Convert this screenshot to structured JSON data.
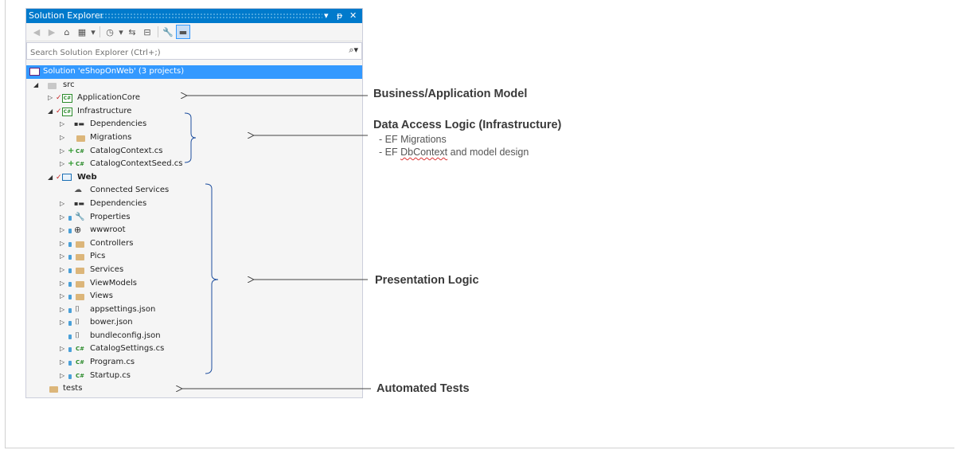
{
  "panel": {
    "title": "Solution Explorer",
    "controls": {
      "dropdown": "▾",
      "pin": "ᵽ",
      "close": "✕"
    },
    "search_placeholder": "Search Solution Explorer (Ctrl+;)"
  },
  "tree": {
    "solution": "Solution 'eShopOnWeb' (3 projects)",
    "src": "src",
    "application_core": "ApplicationCore",
    "infrastructure": "Infrastructure",
    "infra_dependencies": "Dependencies",
    "migrations": "Migrations",
    "catalog_context": "CatalogContext.cs",
    "catalog_context_seed": "CatalogContextSeed.cs",
    "web": "Web",
    "connected_services": "Connected Services",
    "web_dependencies": "Dependencies",
    "properties": "Properties",
    "wwwroot": "wwwroot",
    "controllers": "Controllers",
    "pics": "Pics",
    "services": "Services",
    "viewmodels": "ViewModels",
    "views": "Views",
    "appsettings": "appsettings.json",
    "bower": "bower.json",
    "bundleconfig": "bundleconfig.json",
    "catalog_settings": "CatalogSettings.cs",
    "program": "Program.cs",
    "startup": "Startup.cs",
    "tests": "tests"
  },
  "annotations": {
    "business_model": "Business/Application Model",
    "data_access": "Data Access Logic (Infrastructure)",
    "ef_migrations": "- EF Migrations",
    "ef_prefix": "- EF ",
    "ef_dbcontext": "DbContext",
    "ef_suffix": " and model design",
    "presentation": "Presentation Logic",
    "automated_tests": "Automated Tests"
  },
  "colors": {
    "title_bar": "#007acc",
    "selection": "#3399ff",
    "folder": "#dcb67a",
    "csharp": "#2a8a2a"
  }
}
